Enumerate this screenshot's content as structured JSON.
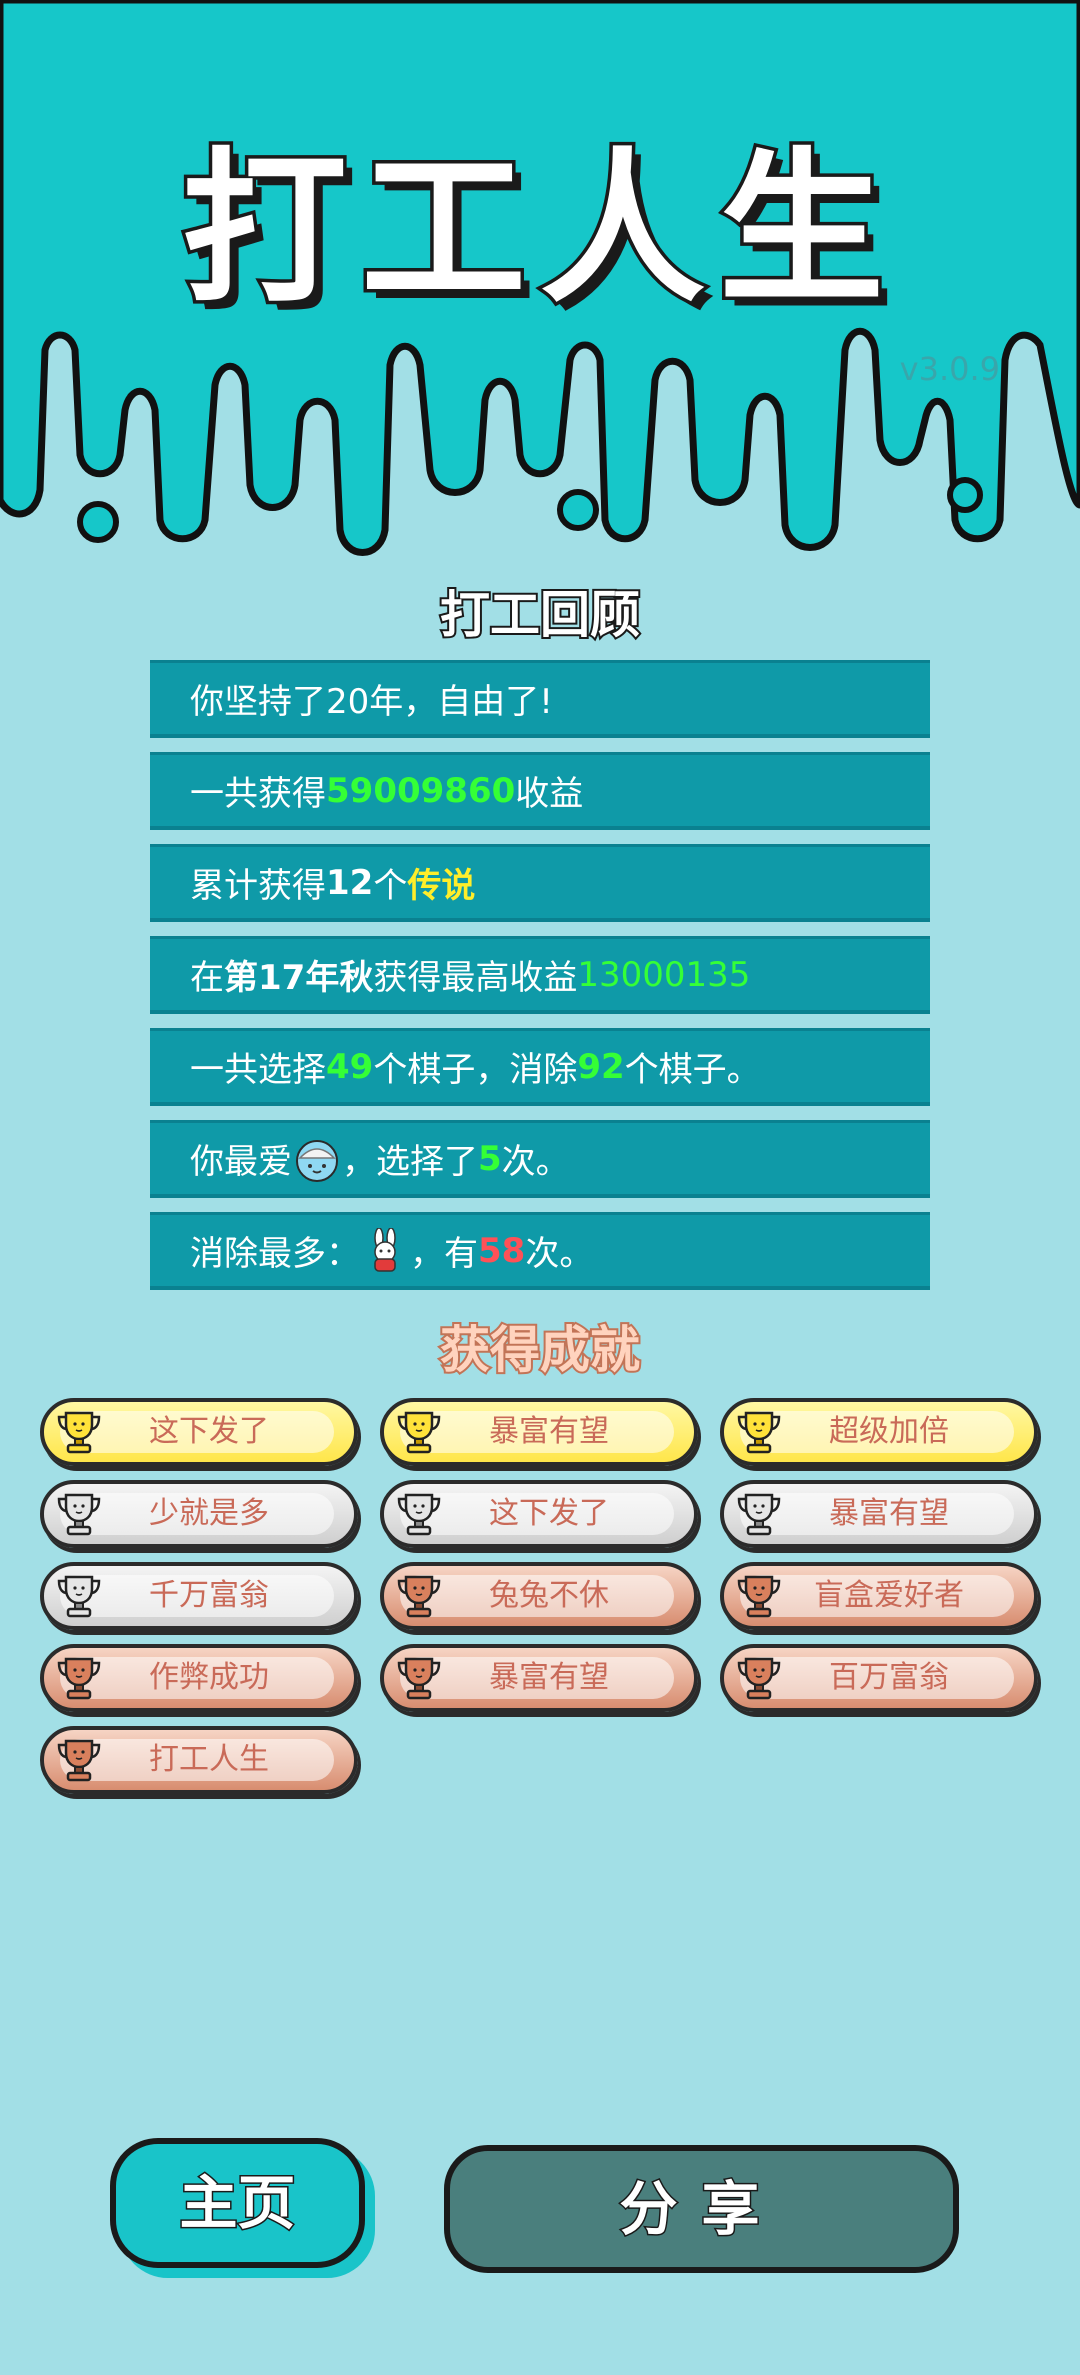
{
  "header": {
    "title": "打工人生",
    "version": "v3.0.9"
  },
  "review": {
    "title": "打工回顾",
    "rows": [
      {
        "text": "你坚持了20年，自由了!"
      },
      {
        "p1": "一共获得",
        "value": "59009860",
        "p2": "收益"
      },
      {
        "p1": "累计获得",
        "value": "12",
        "p2": "个",
        "value2": "传说"
      },
      {
        "p1": "在 ",
        "season": "第17年秋",
        "p2": " 获得最高收益",
        "value": "13000135"
      },
      {
        "p1": "一共选择",
        "value": "49",
        "p2": "个棋子，消除",
        "value2": "92",
        "p3": "个棋子。"
      },
      {
        "p1": "你最爱",
        "icon": "rice-bowl-icon",
        "p2": "，选择了",
        "value": "5",
        "p3": "次。"
      },
      {
        "p1": "消除最多：",
        "icon": "rabbit-icon",
        "p2": "，有",
        "value": "58",
        "p3": "次。"
      }
    ]
  },
  "achievements": {
    "title": "获得成就",
    "items": [
      {
        "label": "这下发了",
        "tier": "gold"
      },
      {
        "label": "暴富有望",
        "tier": "gold"
      },
      {
        "label": "超级加倍",
        "tier": "gold"
      },
      {
        "label": "少就是多",
        "tier": "silver"
      },
      {
        "label": "这下发了",
        "tier": "silver"
      },
      {
        "label": "暴富有望",
        "tier": "silver"
      },
      {
        "label": "千万富翁",
        "tier": "silver"
      },
      {
        "label": "兔兔不休",
        "tier": "bronze"
      },
      {
        "label": "盲盒爱好者",
        "tier": "bronze"
      },
      {
        "label": "作弊成功",
        "tier": "bronze"
      },
      {
        "label": "暴富有望",
        "tier": "bronze"
      },
      {
        "label": "百万富翁",
        "tier": "bronze"
      },
      {
        "label": "打工人生",
        "tier": "bronze"
      }
    ]
  },
  "buttons": {
    "home": "主页",
    "share": "分享"
  },
  "colors": {
    "header_bg": "#16c7c9",
    "page_bg": "#a2dfe6",
    "row_bg": "#0f9aa8",
    "highlight_green": "#35ff36",
    "highlight_yellow": "#ffee2a",
    "highlight_red": "#ff5157"
  }
}
